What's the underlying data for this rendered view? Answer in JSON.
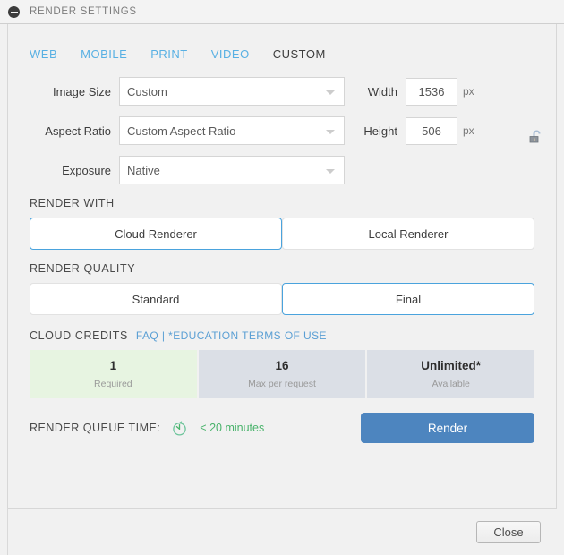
{
  "window": {
    "title": "RENDER SETTINGS",
    "collapse_icon": "minus-circle-icon"
  },
  "tabs": [
    {
      "label": "WEB",
      "active": false
    },
    {
      "label": "MOBILE",
      "active": false
    },
    {
      "label": "PRINT",
      "active": false
    },
    {
      "label": "VIDEO",
      "active": false
    },
    {
      "label": "CUSTOM",
      "active": true
    }
  ],
  "form": {
    "image_size": {
      "label": "Image Size",
      "value": "Custom"
    },
    "aspect_ratio": {
      "label": "Aspect Ratio",
      "value": "Custom Aspect Ratio"
    },
    "exposure": {
      "label": "Exposure",
      "value": "Native"
    },
    "width": {
      "label": "Width",
      "value": "1536",
      "unit": "px"
    },
    "height": {
      "label": "Height",
      "value": "506",
      "unit": "px"
    },
    "lock_icon": "unlock-icon"
  },
  "render_with": {
    "title": "RENDER WITH",
    "options": [
      {
        "label": "Cloud Renderer",
        "selected": true
      },
      {
        "label": "Local Renderer",
        "selected": false
      }
    ]
  },
  "render_quality": {
    "title": "RENDER QUALITY",
    "options": [
      {
        "label": "Standard",
        "selected": false
      },
      {
        "label": "Final",
        "selected": true
      }
    ]
  },
  "cloud_credits": {
    "title": "CLOUD CREDITS",
    "links": "FAQ | *EDUCATION TERMS OF USE",
    "faq_label": "FAQ",
    "separator": " | ",
    "terms_label": "*EDUCATION TERMS OF USE",
    "boxes": [
      {
        "value": "1",
        "caption": "Required",
        "style": "green"
      },
      {
        "value": "16",
        "caption": "Max per request",
        "style": "grey"
      },
      {
        "value": "Unlimited*",
        "caption": "Available",
        "style": "grey"
      }
    ]
  },
  "queue": {
    "label": "RENDER QUEUE TIME:",
    "icon": "stopwatch-icon",
    "value": "< 20 minutes",
    "render_button": "Render"
  },
  "footer": {
    "close_button": "Close"
  },
  "colors": {
    "accent_blue": "#4aa3dd",
    "link_blue": "#5a9fd4",
    "render_button": "#4d85bf",
    "queue_green": "#49b36b",
    "credit_green_bg": "#e7f4e1",
    "credit_grey_bg": "#dbdfe6"
  }
}
